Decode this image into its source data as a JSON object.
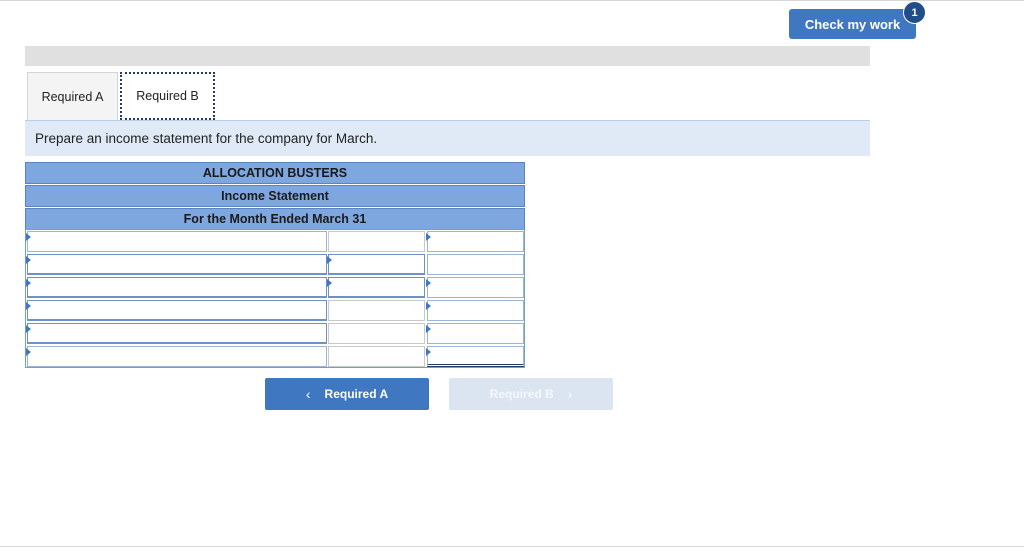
{
  "header": {
    "check_label": "Check my work",
    "badge_count": "1"
  },
  "tabs": [
    {
      "label": "Required A",
      "active": false
    },
    {
      "label": "Required B",
      "active": true
    }
  ],
  "instruction": "Prepare an income statement for the company for March.",
  "statement": {
    "company": "ALLOCATION BUSTERS",
    "title": "Income Statement",
    "period": "For the Month Ended March 31",
    "rows": [
      {
        "label": "",
        "amount_1": "",
        "amount_2": ""
      },
      {
        "label": "",
        "amount_1": "",
        "amount_2": ""
      },
      {
        "label": "",
        "amount_1": "",
        "amount_2": ""
      },
      {
        "label": "",
        "amount_1": "",
        "amount_2": ""
      },
      {
        "label": "",
        "amount_1": "",
        "amount_2": ""
      },
      {
        "label": "",
        "amount_1": "",
        "amount_2": ""
      }
    ]
  },
  "navigation": {
    "prev_label": "Required A",
    "prev_icon": "chevron-left-icon",
    "next_label": "Required B",
    "next_icon": "chevron-right-icon",
    "next_enabled": false
  },
  "colors": {
    "primary": "#3f78c0",
    "header_fill": "#7ea7df",
    "instruction_fill": "#dfeaf6",
    "badge": "#1f4e8a"
  }
}
